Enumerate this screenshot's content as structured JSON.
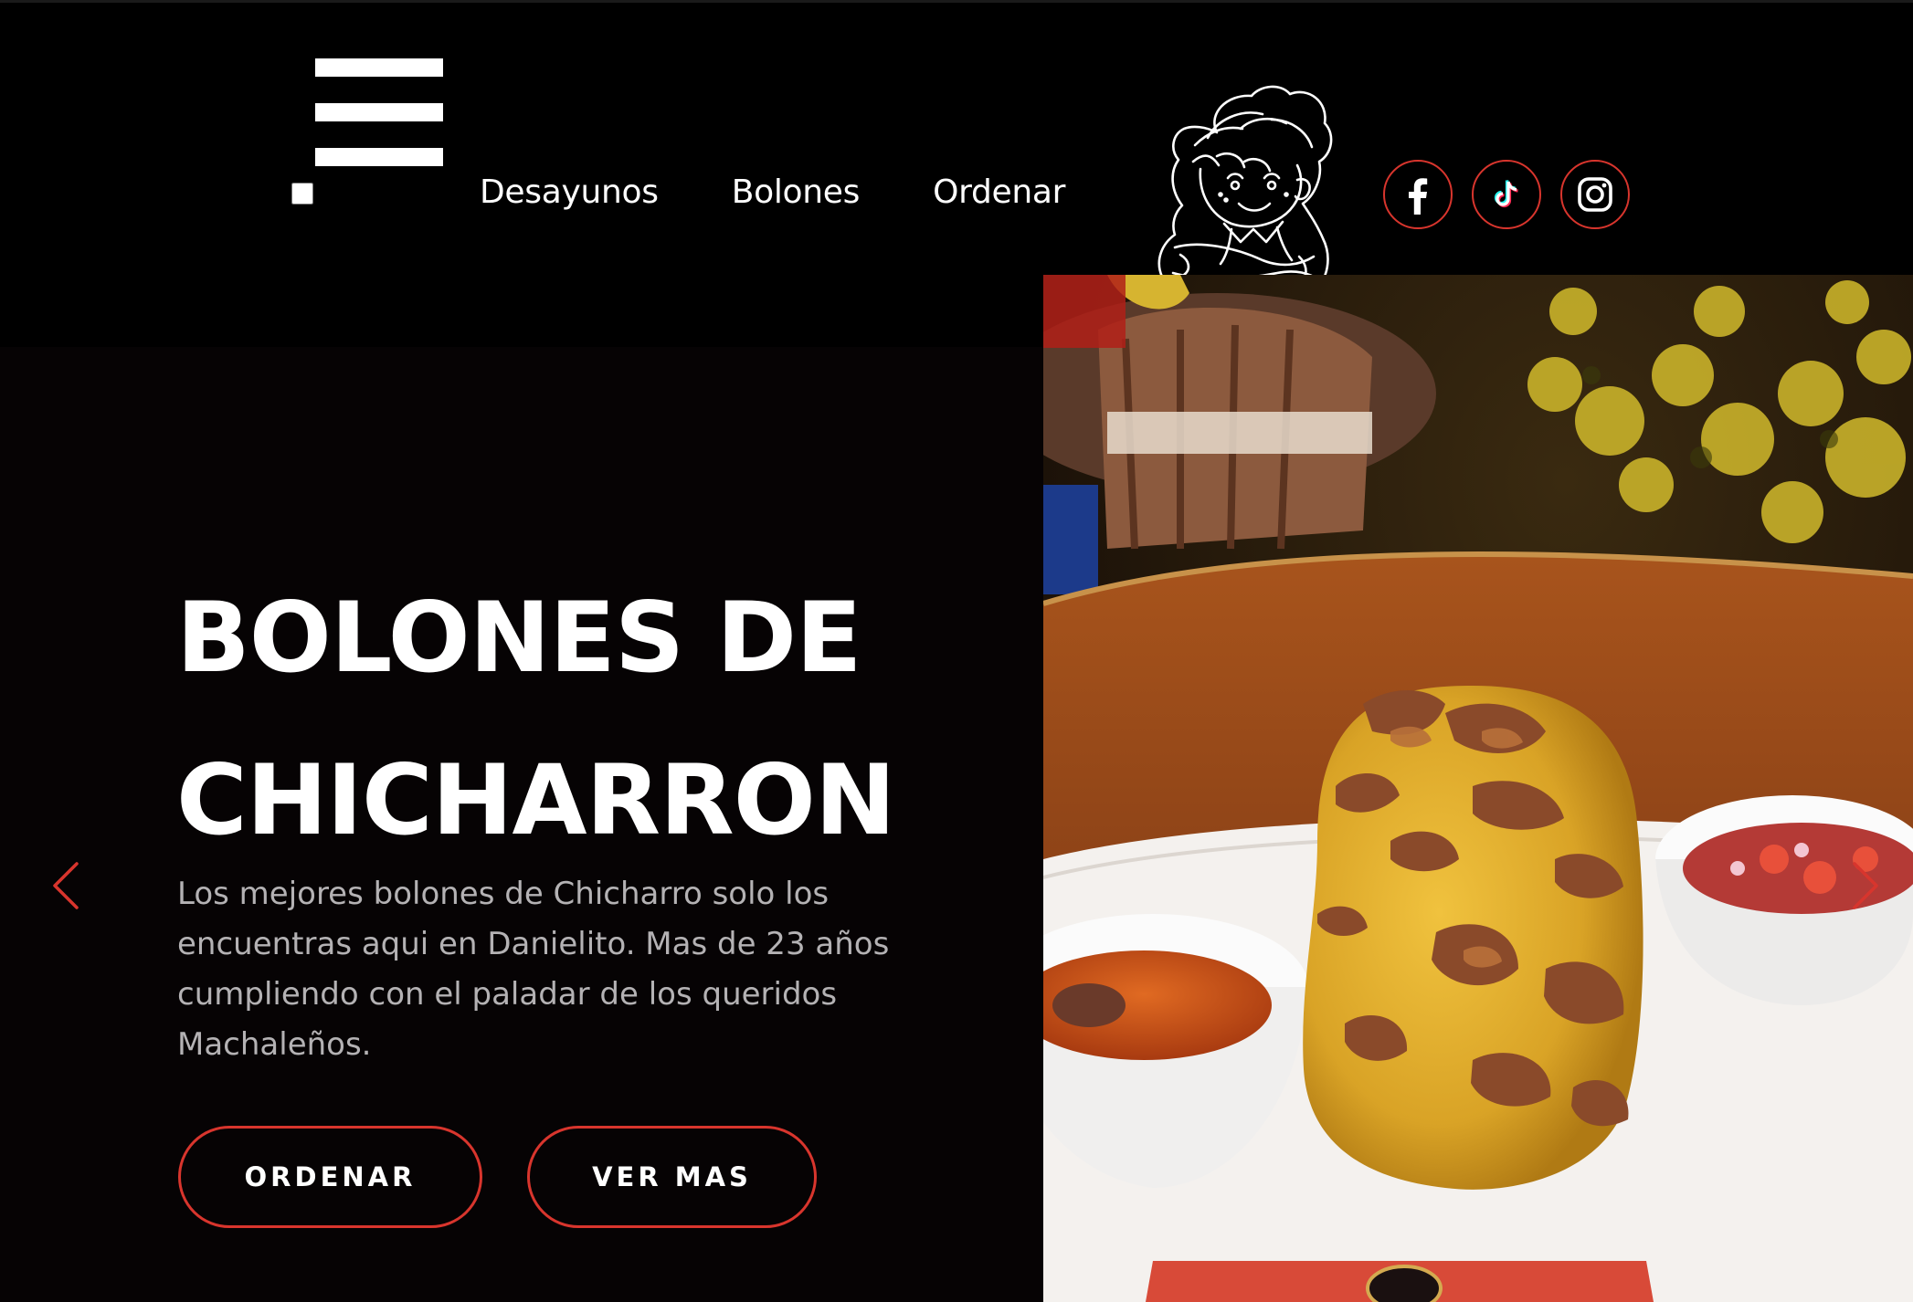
{
  "header": {
    "menu_icon": "hamburger-icon",
    "nav": [
      {
        "label": "Desayunos"
      },
      {
        "label": "Bolones"
      },
      {
        "label": "Ordenar"
      }
    ],
    "logo": "danielito-mascot-logo",
    "socials": [
      {
        "icon": "facebook-icon"
      },
      {
        "icon": "tiktok-icon"
      },
      {
        "icon": "instagram-icon"
      }
    ]
  },
  "hero": {
    "title_line1": "BOLONES DE",
    "title_line2": "CHICHARRON",
    "description": "Los mejores bolones de Chicharro solo los encuentras aqui en Danielito. Mas de 23 años cumpliendo con el paladar de los queridos Machaleños.",
    "buttons": {
      "order": "ORDENAR",
      "more": "VER MAS"
    },
    "photo_subject": "bolon-de-chicharron-photo"
  },
  "colors": {
    "accent": "#d8352d",
    "background": "#060304",
    "header": "#000000",
    "text": "#ffffff",
    "muted_text": "#b4b2b4"
  }
}
